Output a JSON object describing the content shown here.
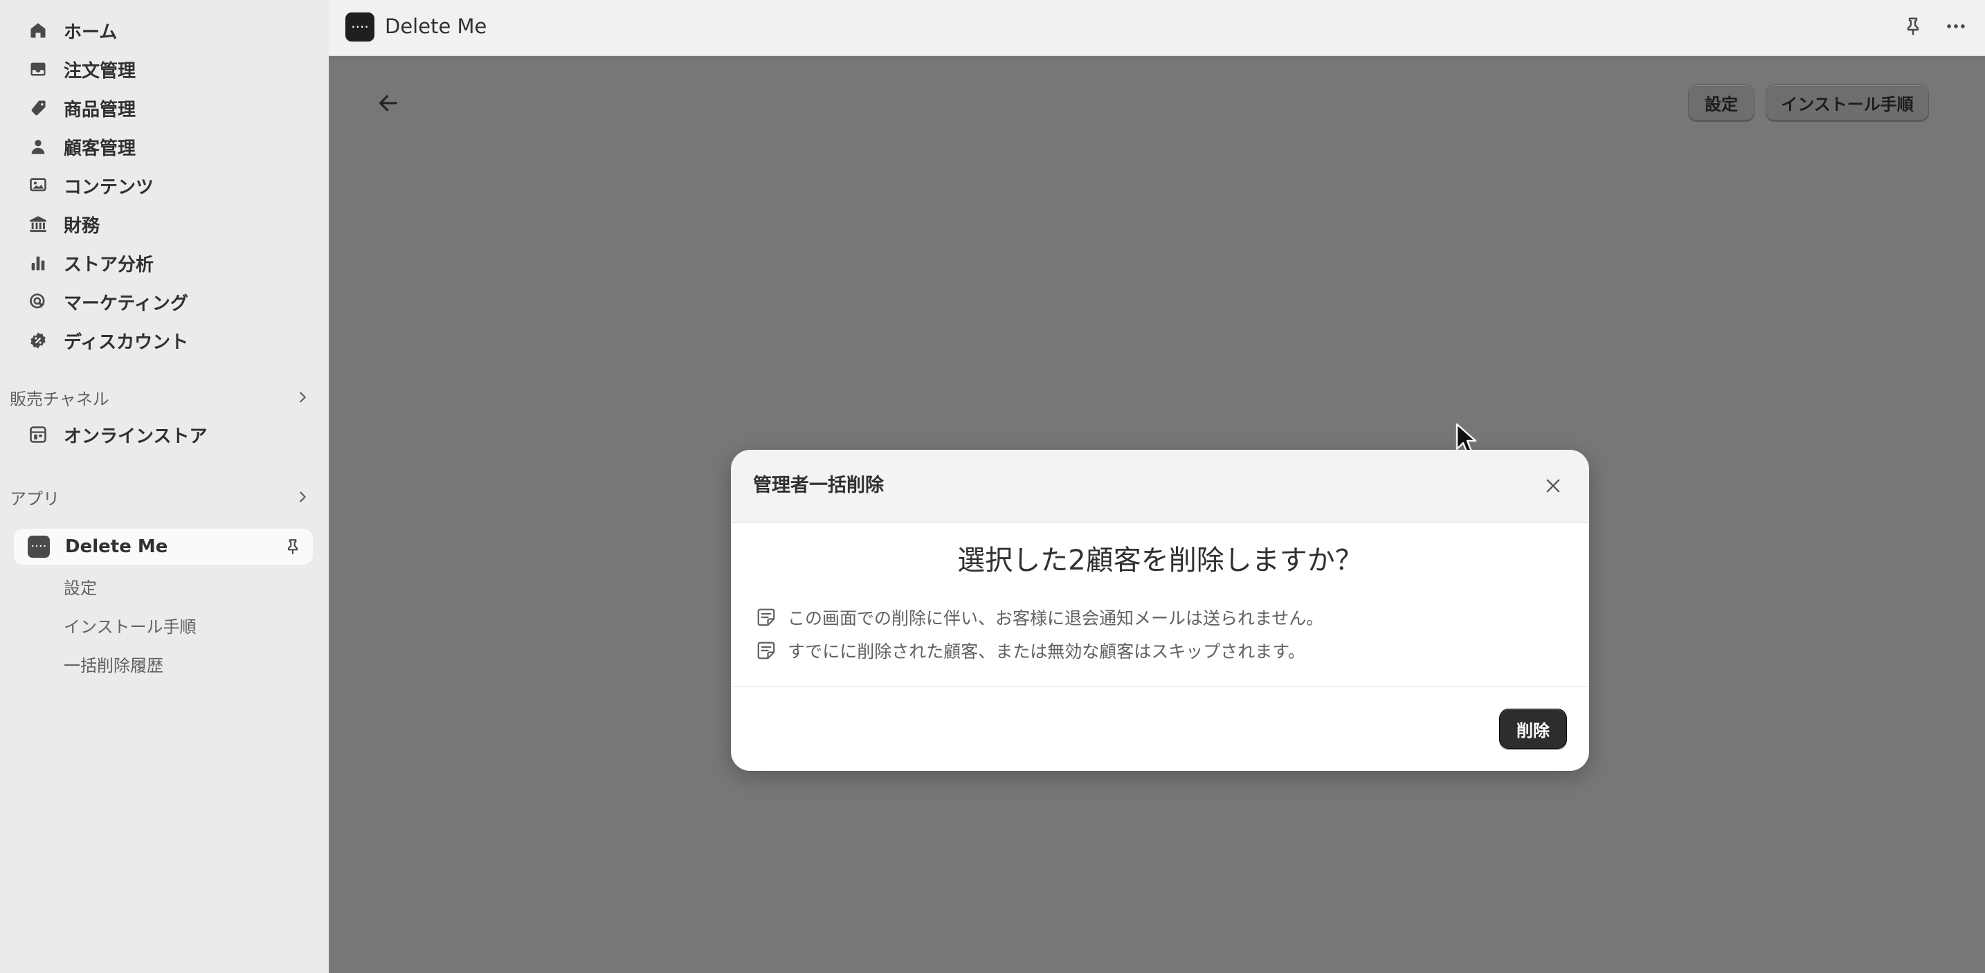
{
  "sidebar": {
    "nav": [
      {
        "label": "ホーム",
        "icon": "home-icon"
      },
      {
        "label": "注文管理",
        "icon": "inbox-icon"
      },
      {
        "label": "商品管理",
        "icon": "tag-icon"
      },
      {
        "label": "顧客管理",
        "icon": "person-icon"
      },
      {
        "label": "コンテンツ",
        "icon": "image-icon"
      },
      {
        "label": "財務",
        "icon": "bank-icon"
      },
      {
        "label": "ストア分析",
        "icon": "bar-chart-icon"
      },
      {
        "label": "マーケティング",
        "icon": "target-icon"
      },
      {
        "label": "ディスカウント",
        "icon": "discount-icon"
      }
    ],
    "sales_channels": {
      "title": "販売チャネル",
      "items": [
        {
          "label": "オンラインストア",
          "icon": "store-icon"
        }
      ]
    },
    "apps": {
      "title": "アプリ",
      "current_app": "Delete Me",
      "sub_items": [
        "設定",
        "インストール手順",
        "一括削除履歴"
      ]
    }
  },
  "topbar": {
    "app_title": "Delete Me"
  },
  "page": {
    "buttons": {
      "settings": "設定",
      "install_guide": "インストール手順"
    }
  },
  "modal": {
    "title": "管理者一括削除",
    "question": "選択した2顧客を削除しますか？",
    "notes": [
      "この画面での削除に伴い、お客様に退会通知メールは送られません。",
      "すでにに削除された顧客、または無効な顧客はスキップされます。"
    ],
    "delete_label": "削除"
  },
  "colors": {
    "sidebar_bg": "#ebebeb",
    "overlay": "#777777",
    "primary_button": "#2d2d2d"
  }
}
